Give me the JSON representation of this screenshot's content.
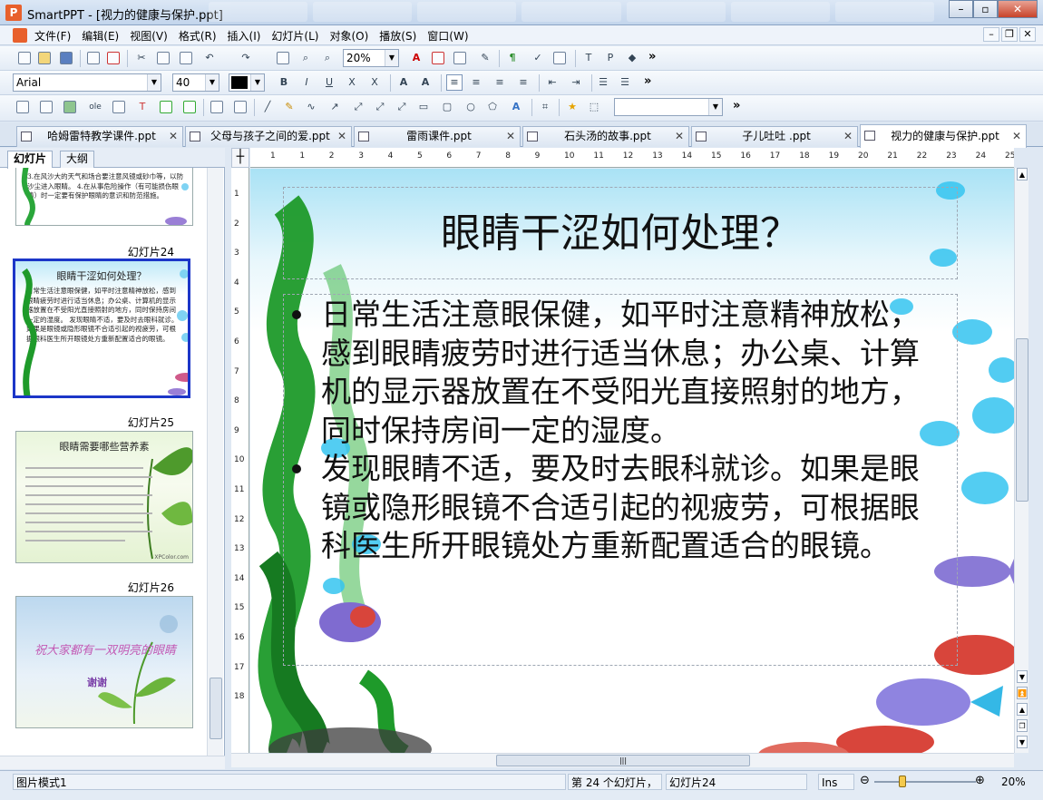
{
  "window": {
    "title": "SmartPPT - [视力的健康与保护.ppt]",
    "app_icon": "P"
  },
  "menu": [
    "文件(F)",
    "编辑(E)",
    "视图(V)",
    "格式(R)",
    "插入(I)",
    "幻灯片(L)",
    "对象(O)",
    "播放(S)",
    "窗口(W)"
  ],
  "toolbar": {
    "zoom_value": "20%",
    "font_name": "Arial",
    "font_size": "40",
    "overflow": "»"
  },
  "doc_tabs": [
    {
      "label": "哈姆雷特教学课件.ppt",
      "active": false
    },
    {
      "label": "父母与孩子之间的爱.ppt",
      "active": false
    },
    {
      "label": "雷雨课件.ppt",
      "active": false
    },
    {
      "label": "石头汤的故事.ppt",
      "active": false
    },
    {
      "label": "子儿吐吐 .ppt",
      "active": false
    },
    {
      "label": "视力的健康与保护.ppt",
      "active": true
    }
  ],
  "left_panel": {
    "tabs": [
      "幻灯片",
      "大纲"
    ],
    "slides": [
      {
        "label": "",
        "text": "3.在风沙大的天气和场合要注意风镜或砂巾等，以防沙尘进入眼睛。 4.在从事危险操作（有可能损伤眼睛）时一定要有保护眼睛的意识和防范措施。"
      },
      {
        "label": "幻灯片24",
        "title": "眼睛干涩如何处理？",
        "text": "日常生活注意眼保健，如平时注意精神放松，感到眼睛疲劳时进行适当休息；办公桌、计算机的显示器放置在不受阳光直接照射的地方，同时保持房间一定的湿度。 发现眼睛不适，要及时去眼科就诊。如果是眼镜或隐形眼镜不合适引起的视疲劳，可根据眼科医生所开眼镜处方重新配置适合的眼镜。"
      },
      {
        "label": "幻灯片25",
        "title": "眼睛需要哪些营养素",
        "footer": "XPColor.com"
      },
      {
        "label": "幻灯片26",
        "title": "祝大家都有一双明亮的眼睛",
        "subtitle": "谢谢"
      }
    ]
  },
  "ruler": {
    "h_ticks": [
      "1",
      "1",
      "2",
      "3",
      "4",
      "5",
      "6",
      "7",
      "8",
      "9",
      "10",
      "11",
      "12",
      "13",
      "14",
      "15",
      "16",
      "17",
      "18",
      "19",
      "20",
      "21",
      "22",
      "23",
      "24",
      "25"
    ],
    "v_ticks": [
      "1",
      "2",
      "3",
      "4",
      "5",
      "6",
      "7",
      "8",
      "9",
      "10",
      "11",
      "12",
      "13",
      "14",
      "15",
      "16",
      "17",
      "18"
    ]
  },
  "slide": {
    "title": "眼睛干涩如何处理？",
    "bullets": [
      "日常生活注意眼保健，如平时注意精神放松，感到眼睛疲劳时进行适当休息；办公桌、计算机的显示器放置在不受阳光直接照射的地方，同时保持房间一定的湿度。",
      "发现眼睛不适，要及时去眼科就诊。如果是眼镜或隐形眼镜不合适引起的视疲劳，可根据眼科医生所开眼镜处方重新配置适合的眼镜。"
    ]
  },
  "status": {
    "mode": "图片模式1",
    "slide_position": "第 24 个幻灯片，",
    "slide_name": "幻灯片24",
    "ins": "Ins",
    "zoom": "20%",
    "zoom_fraction": 0.28
  },
  "colors": {
    "selection_border": "#1c36c8",
    "seaweed": "#1e9a2a",
    "bubble": "#35c4f0"
  }
}
